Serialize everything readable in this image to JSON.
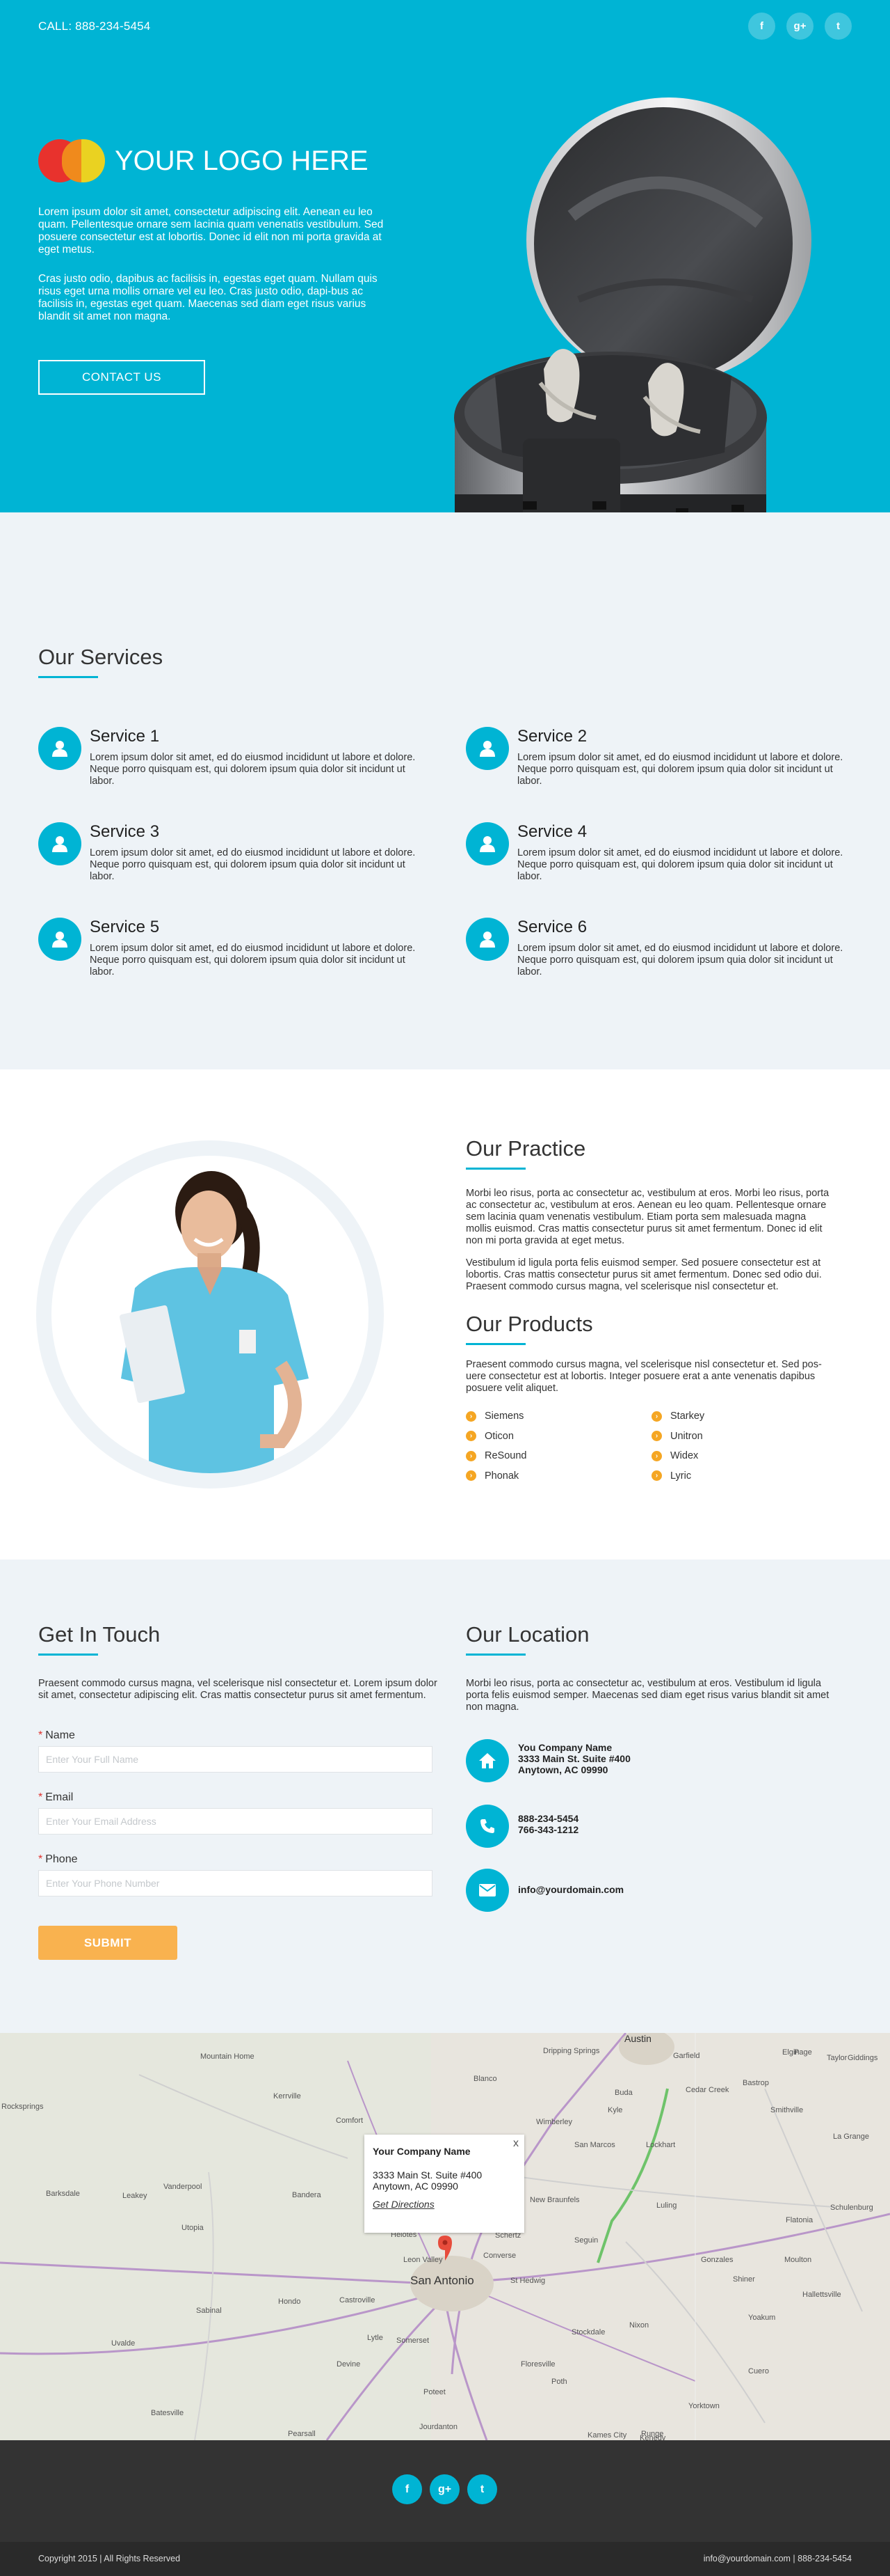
{
  "header": {
    "call_text": "CALL: 888-234-5454",
    "social": [
      {
        "icon": "facebook-icon",
        "glyph": "f"
      },
      {
        "icon": "google-plus-icon",
        "glyph": "g+"
      },
      {
        "icon": "twitter-icon",
        "glyph": "t"
      }
    ]
  },
  "hero": {
    "logo_text": "YOUR LOGO HERE",
    "paragraph1": "Lorem ipsum dolor sit amet, consectetur adipiscing elit. Aenean eu leo quam. Pellentesque ornare sem lacinia quam venenatis vestibulum. Sed posuere consectetur est at lobortis. Donec id elit non mi porta gravida at eget metus.",
    "paragraph2": "Cras justo odio, dapibus ac facilisis in, egestas eget quam. Nullam quis risus eget urna mollis ornare vel eu leo. Cras justo odio, dapi-bus ac facilisis in, egestas eget quam. Maecenas sed diam eget risus varius blandit sit amet non magna.",
    "cta_label": "CONTACT US"
  },
  "services": {
    "title": "Our Services",
    "items": [
      {
        "name": "Service 1",
        "desc": "Lorem ipsum dolor sit amet, ed do eiusmod incididunt ut labore et dolore. Neque porro quisquam est, qui dolorem ipsum quia dolor sit incidunt ut labor."
      },
      {
        "name": "Service 2",
        "desc": "Lorem ipsum dolor sit amet, ed do eiusmod incididunt ut labore et dolore. Neque porro quisquam est, qui dolorem ipsum quia dolor sit incidunt ut labor."
      },
      {
        "name": "Service 3",
        "desc": "Lorem ipsum dolor sit amet, ed do eiusmod incididunt ut labore et dolore. Neque porro quisquam est, qui dolorem ipsum quia dolor sit incidunt ut labor."
      },
      {
        "name": "Service 4",
        "desc": "Lorem ipsum dolor sit amet, ed do eiusmod incididunt ut labore et dolore. Neque porro quisquam est, qui dolorem ipsum quia dolor sit incidunt ut labor."
      },
      {
        "name": "Service 5",
        "desc": "Lorem ipsum dolor sit amet, ed do eiusmod incididunt ut labore et dolore. Neque porro quisquam est, qui dolorem ipsum quia dolor sit incidunt ut labor."
      },
      {
        "name": "Service 6",
        "desc": "Lorem ipsum dolor sit amet, ed do eiusmod incididunt ut labore et dolore. Neque porro quisquam est, qui dolorem ipsum quia dolor sit incidunt ut labor."
      }
    ]
  },
  "practice": {
    "title": "Our Practice",
    "paragraph1": "Morbi leo risus, porta ac consectetur ac, vestibulum at eros. Morbi leo risus, porta ac consectetur ac, vestibulum at eros. Aenean eu leo quam. Pellentesque ornare sem lacinia quam venenatis vestibulum. Etiam porta sem malesuada magna mollis euismod. Cras mattis consectetur purus sit amet fermentum. Donec id elit non mi porta gravida at eget metus.",
    "paragraph2": "Vestibulum id ligula porta felis euismod semper. Sed posuere consectetur est at lobortis. Cras mattis consectetur purus sit amet fermentum. Donec sed odio dui. Praesent commodo cursus magna, vel scelerisque nisl consectetur et."
  },
  "products": {
    "title": "Our Products",
    "intro": "Praesent commodo cursus magna, vel scelerisque nisl consectetur et. Sed pos-uere consectetur est at lobortis. Integer posuere erat a ante venenatis dapibus posuere velit aliquet.",
    "col1": [
      "Siemens",
      "Oticon",
      "ReSound",
      "Phonak"
    ],
    "col2": [
      "Starkey",
      "Unitron",
      "Widex",
      "Lyric"
    ]
  },
  "contact": {
    "title": "Get In Touch",
    "intro": "Praesent commodo cursus magna, vel scelerisque nisl consectetur et. Lorem ipsum dolor sit amet, consectetur adipiscing elit. Cras mattis consectetur purus sit amet fermentum.",
    "fields": [
      {
        "label": "Name",
        "placeholder": "Enter Your Full Name"
      },
      {
        "label": "Email",
        "placeholder": "Enter Your Email Address"
      },
      {
        "label": "Phone",
        "placeholder": "Enter Your Phone Number"
      }
    ],
    "submit_label": "SUBMIT"
  },
  "location": {
    "title": "Our Location",
    "intro": "Morbi leo risus, porta ac consectetur ac, vestibulum at eros. Vestibulum id ligula porta felis euismod semper. Maecenas sed diam eget risus varius blandit sit amet non magna.",
    "address": [
      "You Company Name",
      "3333 Main St. Suite #400",
      "Anytown, AC 09990"
    ],
    "phones": [
      "888-234-5454",
      "766-343-1212"
    ],
    "email": "info@yourdomain.com"
  },
  "map": {
    "popup_title": "Your Company Name",
    "popup_line1": "3333 Main St. Suite #400",
    "popup_line2": "Anytown, AC 09990",
    "popup_link": "Get Directions",
    "close": "x",
    "labels": [
      "Austin",
      "Mountain Home",
      "Kerrville",
      "Comfort",
      "Rocksprings",
      "Barksdale",
      "Leakey",
      "Vanderpool",
      "Bandera",
      "Utopia",
      "Hondo",
      "Castroville",
      "Sabinal",
      "Uvalde",
      "Devine",
      "Lytle",
      "Somerset",
      "Poteet",
      "Pearsall",
      "Jourdanton",
      "Batesville",
      "Floresville",
      "Poth",
      "Kenedy",
      "Runge",
      "Kames City",
      "Yorktown",
      "Cuero",
      "Nixon",
      "Stockdale",
      "Seguin",
      "San Marcos",
      "Lockhart",
      "New Braunfels",
      "Luling",
      "Gonzales",
      "Shiner",
      "Yoakum",
      "Hallettsville",
      "Moulton",
      "Flatonia",
      "Schulenburg",
      "La Grange",
      "Smithville",
      "Bastrop",
      "Elgin",
      "Taylor",
      "Giddings",
      "Cedar Creek",
      "Buda",
      "Kyle",
      "Dripping Springs",
      "Wimberley",
      "Blanco",
      "Garfield",
      "Page",
      "San Antonio",
      "Converse",
      "Schertz",
      "St Hedwig",
      "Leon Valley",
      "Helotes"
    ],
    "accent": "#e74c3c"
  },
  "footer": {
    "social": [
      {
        "icon": "facebook-icon",
        "glyph": "f"
      },
      {
        "icon": "google-plus-icon",
        "glyph": "g+"
      },
      {
        "icon": "twitter-icon",
        "glyph": "t"
      }
    ],
    "copyright": "Copyright 2015 | All Rights Reserved",
    "contact": "info@yourdomain.com | 888-234-5454"
  },
  "colors": {
    "primary": "#00b4d4",
    "accent": "#f9b24f",
    "light_bg": "#eef3f7",
    "footer": "#333333"
  }
}
